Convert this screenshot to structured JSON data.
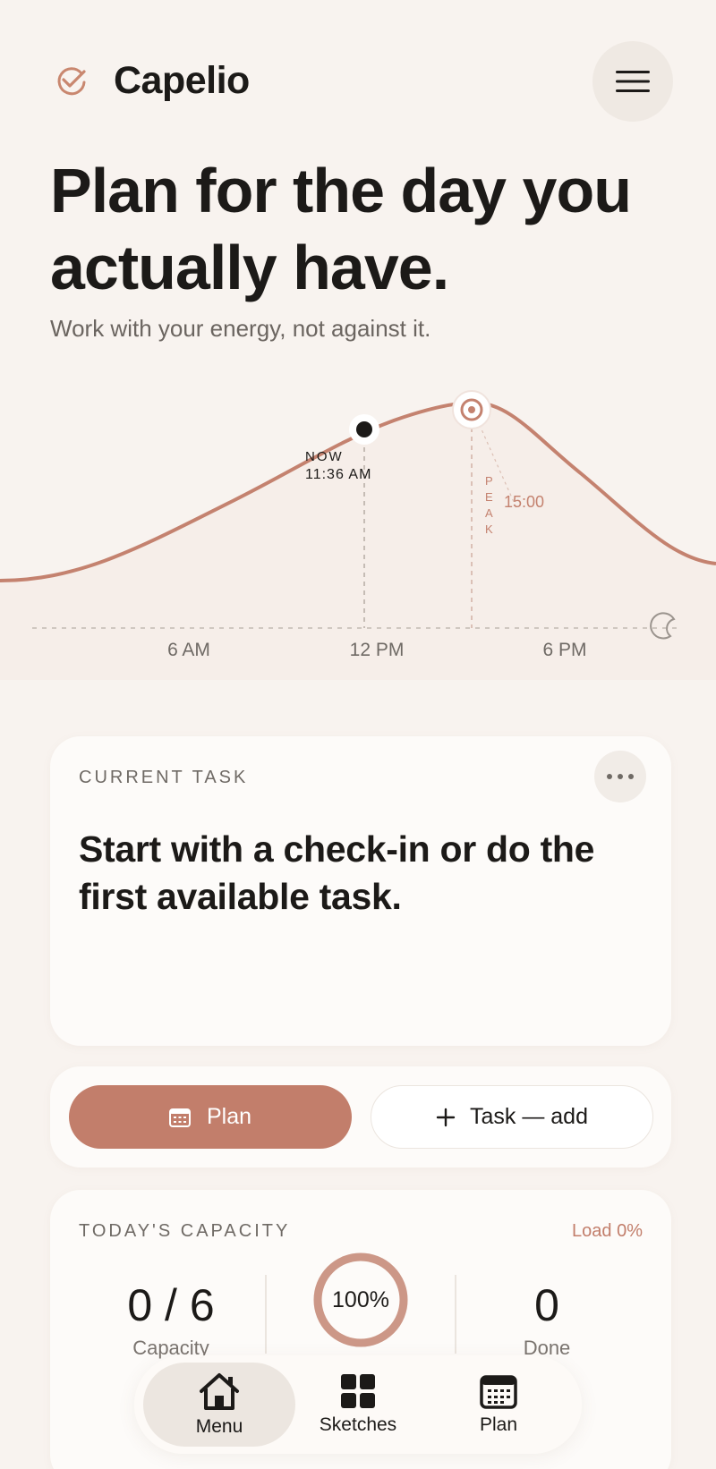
{
  "app": {
    "title": "Capelio"
  },
  "header": {
    "menu_icon": "hamburger-icon"
  },
  "hero": {
    "title": "Plan for the day you actually have.",
    "subtitle": "Work with your energy, not against it."
  },
  "energy_curve": {
    "now_label": "NOW",
    "now_time": "11:36 AM",
    "now_hour": 11.6,
    "peak_label": "PEAK",
    "peak_time": "15:00",
    "peak_hour": 15,
    "ticks": [
      "6 AM",
      "12 PM",
      "6 PM"
    ],
    "night_icon": "moon-icon"
  },
  "current_task": {
    "label": "CURRENT TASK",
    "text": "Start with a check-in or do the first available task.",
    "more_icon": "more-horizontal-icon"
  },
  "actions": {
    "plan_label": "Plan",
    "plan_icon": "calendar-icon",
    "task_label": "Task — add",
    "task_icon": "plus-icon"
  },
  "capacity": {
    "label": "TODAY'S CAPACITY",
    "load": "Load 0%",
    "capacity_value": "0 / 6",
    "capacity_label": "Capacity",
    "percent": "100%",
    "percent_fraction": 1.0,
    "done_value": "0",
    "done_label": "Done"
  },
  "nav": {
    "items": [
      {
        "label": "Menu",
        "icon": "home-icon",
        "active": true
      },
      {
        "label": "Sketches",
        "icon": "grid-icon",
        "active": false
      },
      {
        "label": "Plan",
        "icon": "calendar-icon",
        "active": false
      }
    ]
  },
  "colors": {
    "accent": "#c27e6b",
    "background": "#f8f3ef",
    "text": "#1c1a18"
  }
}
